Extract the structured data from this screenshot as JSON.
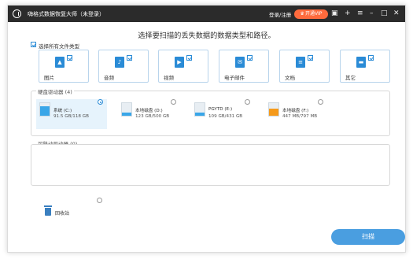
{
  "titlebar": {
    "title": "嗨格式数据恢复大师（未登录）",
    "login": "登录/注册",
    "vip": "开通VIP",
    "icons": [
      "logo-icon",
      "chat-icon",
      "plus-icon",
      "menu-icon",
      "minimize-icon",
      "maximize-icon",
      "close-icon"
    ]
  },
  "heading": "选择要扫描的丢失数据的数据类型和路径。",
  "file_types": {
    "select_all": "选择所有文件类型",
    "items": [
      {
        "label": "图片",
        "icon": "image-icon"
      },
      {
        "label": "音频",
        "icon": "audio-icon"
      },
      {
        "label": "视频",
        "icon": "video-icon"
      },
      {
        "label": "电子邮件",
        "icon": "email-icon"
      },
      {
        "label": "文档",
        "icon": "document-icon"
      },
      {
        "label": "其它",
        "icon": "other-icon"
      }
    ]
  },
  "hard_drives": {
    "title": "硬盘驱动器",
    "count": "(4)",
    "items": [
      {
        "name": "系统 (C:)",
        "size": "91.5 GB/118 GB",
        "fill_fraction": 0.78,
        "fill_color": "#39a6e8",
        "selected": true
      },
      {
        "name": "本地磁盘 (D:)",
        "size": "123 GB/500 GB",
        "fill_fraction": 0.25,
        "fill_color": "#39a6e8",
        "selected": false
      },
      {
        "name": "PGYTD (E:)",
        "size": "109 GB/431 GB",
        "fill_fraction": 0.25,
        "fill_color": "#39a6e8",
        "selected": false
      },
      {
        "name": "本地磁盘 (F:)",
        "size": "447 MB/797 MB",
        "fill_fraction": 0.56,
        "fill_color": "#f59a1b",
        "selected": false
      }
    ]
  },
  "removable": {
    "title": "可移动驱动器",
    "count": "(0)"
  },
  "recycle": {
    "label": "回收站"
  },
  "scan_button": "扫描",
  "colors": {
    "accent": "#2a8bd6",
    "scan_button": "#4a9ee0",
    "titlebar": "#2b2b2b",
    "vip": "#ff6b3d"
  }
}
